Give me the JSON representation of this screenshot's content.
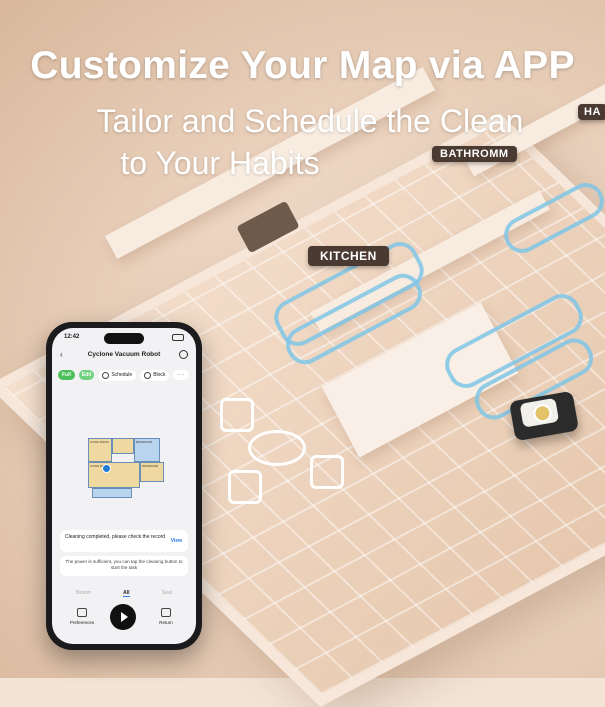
{
  "banner": {
    "headline": "Customize Your Map via APP",
    "subline1": "Tailor and Schedule the Clean",
    "subline2": "to Your Habits"
  },
  "room_tags": {
    "kitchen": "KITCHEN",
    "bathroom": "BATHROMM",
    "cut_off": "HA"
  },
  "phone": {
    "status_time": "12:42",
    "title": "Cyclone Vacuum Robot",
    "chips": {
      "mode1": "Full",
      "mode2": "Edit",
      "schedule": "Schedule",
      "block": "Block",
      "more": "···"
    },
    "map_rooms": [
      "LIVING ROOM",
      "",
      "BATHROOM",
      "LIVING ROOM",
      "BATHROOM",
      ""
    ],
    "card1": {
      "text": "Cleaning completed, please check the record",
      "action": "View"
    },
    "card2": {
      "text": "The power is sufficient, you can tap the cleaning button to start the task"
    },
    "tabs": [
      "Broom",
      "All",
      "Seal"
    ],
    "active_tab": "All",
    "bottom": {
      "left": "Preferences",
      "right": "Return"
    }
  },
  "colors": {
    "accent_green": "#4cbe5a",
    "link_blue": "#2f7ae5",
    "path_blue": "#7fc6e6",
    "tag_bg": "#4a3a31"
  }
}
